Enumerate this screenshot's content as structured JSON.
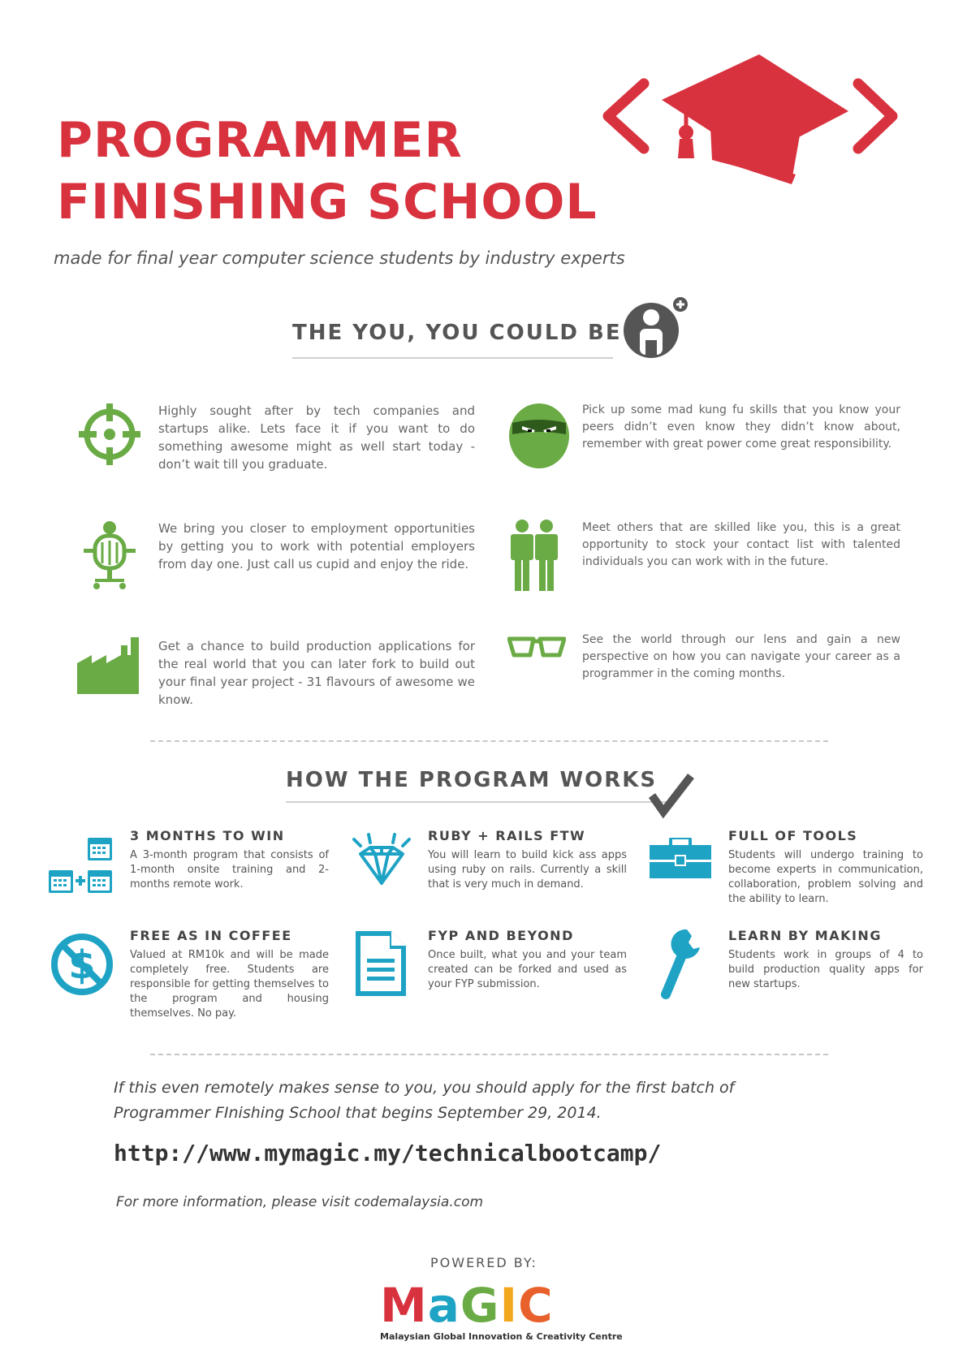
{
  "header": {
    "title_line1": "PROGRAMMER",
    "title_line2": "FINISHING SCHOOL",
    "subtitle": "made for final year computer science students by industry experts"
  },
  "section_you": {
    "heading": "THE YOU, YOU COULD BE",
    "items": [
      {
        "icon": "target-icon",
        "text": "Highly sought after by tech companies and startups alike. Lets face it if you want to do something awesome might as well start today - don’t wait till you graduate."
      },
      {
        "icon": "ninja-icon",
        "text": "Pick up some mad kung fu skills that you know your peers didn’t even know they didn’t know about, remember with great power come great responsibility."
      },
      {
        "icon": "office-chair-icon",
        "text": "We bring you closer to employment opportunities by getting you to work with potential employers from day one. Just call us cupid and enjoy the ride."
      },
      {
        "icon": "two-people-icon",
        "text": "Meet others that are skilled like you, this is a great opportunity to stock your contact list with talented individuals you can work with in the future."
      },
      {
        "icon": "factory-icon",
        "text": "Get a chance to build production applications for the real world that you can later fork to build out your final year project - 31 flavours of awesome we know."
      },
      {
        "icon": "glasses-icon",
        "text": "See the world through our lens and gain a new perspective on how you can navigate your career as a programmer in the coming months."
      }
    ]
  },
  "section_how": {
    "heading": "HOW THE PROGRAM WORKS",
    "steps": [
      {
        "icon": "calendar-icon",
        "title": "3 MONTHS TO WIN",
        "text": "A 3-month program that consists of 1-month onsite training and 2-months remote work."
      },
      {
        "icon": "diamond-icon",
        "title": "RUBY +  RAILS FTW",
        "text": "You will learn to build kick ass apps using ruby on rails. Currently a skill that is very much in demand."
      },
      {
        "icon": "toolbox-icon",
        "title": "FULL OF TOOLS",
        "text": "Students will undergo training to become experts in communication, collaboration, problem solving and the ability to learn."
      },
      {
        "icon": "no-dollar-icon",
        "title": "FREE AS IN COFFEE",
        "text": "Valued at RM10k and will be made completely free. Students are responsible for getting themselves to the program and housing themselves. No pay."
      },
      {
        "icon": "document-icon",
        "title": "FYP AND BEYOND",
        "text": "Once built, what you and your team created can be forked and used as your FYP submission."
      },
      {
        "icon": "wrench-icon",
        "title": "LEARN BY MAKING",
        "text": "Students work in groups of 4 to build production quality apps for new startups."
      }
    ]
  },
  "cta": {
    "line1": "If this even remotely makes sense to you, you should apply for the first batch of",
    "line2": "Programmer FInishing School that begins September 29, 2014.",
    "url": "http://www.mymagic.my/technicalbootcamp/",
    "more_info": "For more information, please visit codemalaysia.com"
  },
  "footer": {
    "powered_by": "POWERED BY:",
    "logo_letters": [
      "M",
      "a",
      "G",
      "I",
      "C"
    ],
    "logo_subtitle": "Malaysian Global Innovation & Creativity Centre"
  },
  "colors": {
    "title_red": "#d8323f",
    "green": "#6aab45",
    "teal": "#1ea3c5",
    "gray": "#555555"
  }
}
